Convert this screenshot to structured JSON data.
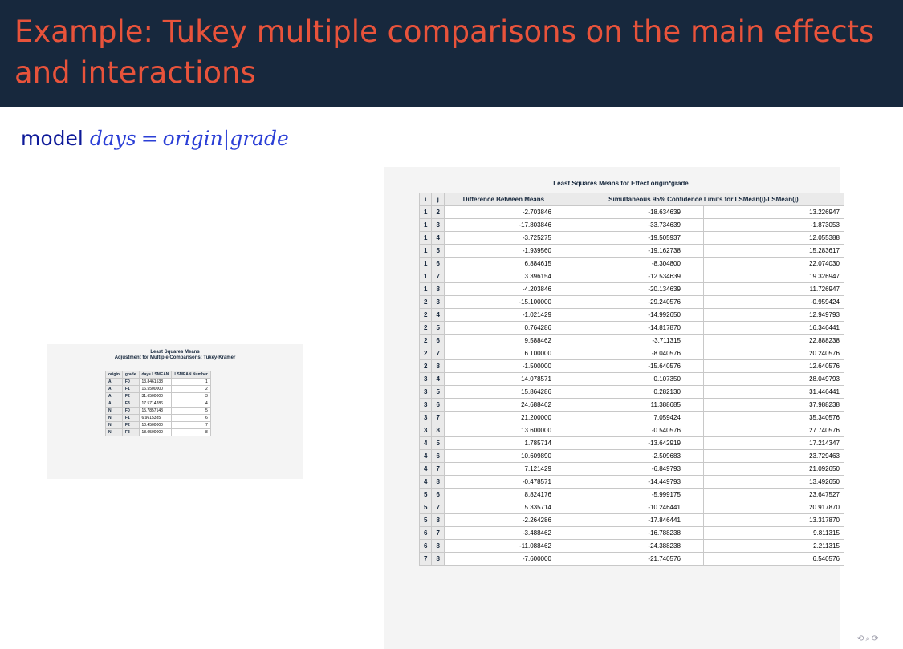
{
  "title": "Example: Tukey multiple comparisons on the main effects and interactions",
  "model": {
    "prefix": "model",
    "lhs": "days",
    "eq": "=",
    "term1": "origin",
    "sep": "|",
    "term2": "grade"
  },
  "small_table": {
    "head1": "Least Squares Means",
    "head2": "Adjustment for Multiple Comparisons: Tukey-Kramer",
    "columns": [
      "origin",
      "grade",
      "days LSMEAN",
      "LSMEAN Number"
    ],
    "rows": [
      [
        "A",
        "F0",
        "13.8461538",
        "1"
      ],
      [
        "A",
        "F1",
        "16.5500000",
        "2"
      ],
      [
        "A",
        "F2",
        "31.6500000",
        "3"
      ],
      [
        "A",
        "F3",
        "17.5714286",
        "4"
      ],
      [
        "N",
        "F0",
        "15.7857143",
        "5"
      ],
      [
        "N",
        "F1",
        "6.9615385",
        "6"
      ],
      [
        "N",
        "F2",
        "10.4500000",
        "7"
      ],
      [
        "N",
        "F3",
        "18.0500000",
        "8"
      ]
    ]
  },
  "big_table": {
    "head": "Least Squares Means for Effect origin*grade",
    "columns": [
      "i",
      "j",
      "Difference Between Means",
      "Simultaneous 95% Confidence Limits for LSMean(i)-LSMean(j)"
    ],
    "rows": [
      [
        "1",
        "2",
        "-2.703846",
        "-18.634639",
        "13.226947"
      ],
      [
        "1",
        "3",
        "-17.803846",
        "-33.734639",
        "-1.873053"
      ],
      [
        "1",
        "4",
        "-3.725275",
        "-19.505937",
        "12.055388"
      ],
      [
        "1",
        "5",
        "-1.939560",
        "-19.162738",
        "15.283617"
      ],
      [
        "1",
        "6",
        "6.884615",
        "-8.304800",
        "22.074030"
      ],
      [
        "1",
        "7",
        "3.396154",
        "-12.534639",
        "19.326947"
      ],
      [
        "1",
        "8",
        "-4.203846",
        "-20.134639",
        "11.726947"
      ],
      [
        "2",
        "3",
        "-15.100000",
        "-29.240576",
        "-0.959424"
      ],
      [
        "2",
        "4",
        "-1.021429",
        "-14.992650",
        "12.949793"
      ],
      [
        "2",
        "5",
        "0.764286",
        "-14.817870",
        "16.346441"
      ],
      [
        "2",
        "6",
        "9.588462",
        "-3.711315",
        "22.888238"
      ],
      [
        "2",
        "7",
        "6.100000",
        "-8.040576",
        "20.240576"
      ],
      [
        "2",
        "8",
        "-1.500000",
        "-15.640576",
        "12.640576"
      ],
      [
        "3",
        "4",
        "14.078571",
        "0.107350",
        "28.049793"
      ],
      [
        "3",
        "5",
        "15.864286",
        "0.282130",
        "31.446441"
      ],
      [
        "3",
        "6",
        "24.688462",
        "11.388685",
        "37.988238"
      ],
      [
        "3",
        "7",
        "21.200000",
        "7.059424",
        "35.340576"
      ],
      [
        "3",
        "8",
        "13.600000",
        "-0.540576",
        "27.740576"
      ],
      [
        "4",
        "5",
        "1.785714",
        "-13.642919",
        "17.214347"
      ],
      [
        "4",
        "6",
        "10.609890",
        "-2.509683",
        "23.729463"
      ],
      [
        "4",
        "7",
        "7.121429",
        "-6.849793",
        "21.092650"
      ],
      [
        "4",
        "8",
        "-0.478571",
        "-14.449793",
        "13.492650"
      ],
      [
        "5",
        "6",
        "8.824176",
        "-5.999175",
        "23.647527"
      ],
      [
        "5",
        "7",
        "5.335714",
        "-10.246441",
        "20.917870"
      ],
      [
        "5",
        "8",
        "-2.264286",
        "-17.846441",
        "13.317870"
      ],
      [
        "6",
        "7",
        "-3.488462",
        "-16.788238",
        "9.811315"
      ],
      [
        "6",
        "8",
        "-11.088462",
        "-24.388238",
        "2.211315"
      ],
      [
        "7",
        "8",
        "-7.600000",
        "-21.740576",
        "6.540576"
      ]
    ]
  },
  "nav": "⟲⌕⟳",
  "colors": {
    "title_bg": "#17283d",
    "title_text": "#e8533b",
    "math": "#2b3fd6"
  }
}
